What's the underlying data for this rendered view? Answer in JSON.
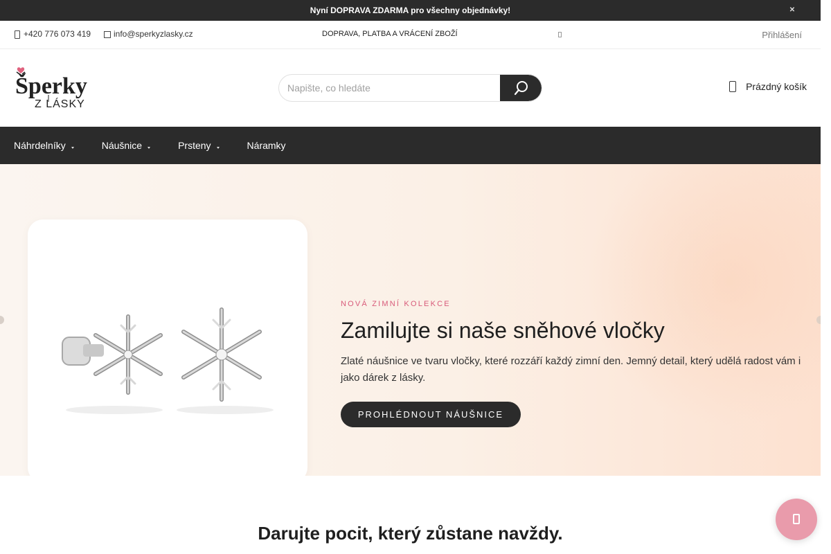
{
  "announcement": {
    "text": "Nyní DOPRAVA ZDARMA pro všechny objednávky!",
    "close_icon": "close-icon"
  },
  "topbar": {
    "phone": "+420 776 073 419",
    "email": "info@sperkyzlasky.cz",
    "shipping_link": "DOPRAVA, PLATBA A VRÁCENÍ ZBOŽÍ",
    "login": "Přihlášení"
  },
  "header": {
    "logo_text": "Šperky",
    "logo_subtext": "Z LÁSKY",
    "search": {
      "placeholder": "Napište, co hledáte"
    },
    "cart_label": "Prázdný košík"
  },
  "nav": {
    "items": [
      {
        "label": "Náhrdelníky",
        "has_submenu": true
      },
      {
        "label": "Náušnice",
        "has_submenu": true
      },
      {
        "label": "Prsteny",
        "has_submenu": true
      },
      {
        "label": "Náramky",
        "has_submenu": false
      }
    ]
  },
  "hero": {
    "eyebrow": "NOVÁ ZIMNÍ KOLEKCE",
    "title": "Zamilujte si naše sněhové vločky",
    "description": "Zlaté náušnice ve tvaru vločky, které rozzáří každý zimní den. Jemný detail, který udělá radost vám i jako dárek z lásky.",
    "cta": "PROHLÉDNOUT NÁUŠNICE"
  },
  "section": {
    "title": "Darujte pocit, který zůstane navždy."
  },
  "colors": {
    "dark": "#2b2b2b",
    "accent_pink": "#d85a7a",
    "chat_pink": "#e99bab"
  }
}
